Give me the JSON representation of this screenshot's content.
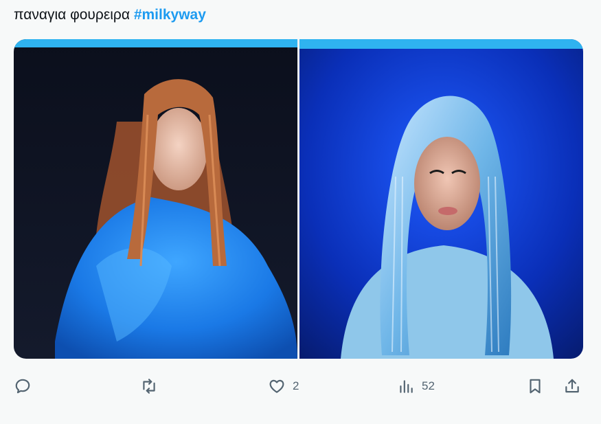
{
  "tweet": {
    "text": "παναγια φουρειρα",
    "hashtag": "#milkyway"
  },
  "media": {
    "images": [
      {
        "alt": "Woman with long braided hair in blue puffer jacket"
      },
      {
        "alt": "Woman wearing crystal beaded headdress on blue background"
      }
    ]
  },
  "actions": {
    "reply": {
      "icon": "reply-icon",
      "count": ""
    },
    "retweet": {
      "icon": "retweet-icon",
      "count": ""
    },
    "like": {
      "icon": "heart-icon",
      "count": "2"
    },
    "views": {
      "icon": "views-icon",
      "count": "52"
    },
    "bookmark": {
      "icon": "bookmark-icon"
    },
    "share": {
      "icon": "share-icon"
    }
  },
  "colors": {
    "background": "#f7f9f9",
    "text": "#0f1419",
    "hashtag": "#1d9bf0",
    "icon": "#536471"
  }
}
